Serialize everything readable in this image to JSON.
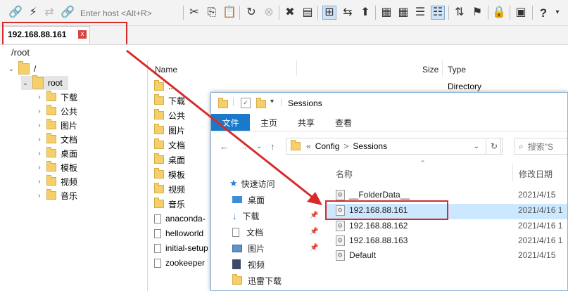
{
  "toolbar": {
    "host_placeholder": "Enter host <Alt+R>",
    "help_label": "?"
  },
  "tab": {
    "label": "192.168.88.161",
    "close": "x"
  },
  "path": "/root",
  "tree": {
    "root_slash": "/",
    "root_label": "root",
    "children": [
      "下载",
      "公共",
      "图片",
      "文档",
      "桌面",
      "模板",
      "视频",
      "音乐"
    ]
  },
  "filelist": {
    "headers": {
      "name": "Name",
      "size": "Size",
      "type": "Type"
    },
    "rows": [
      {
        "name": "..",
        "type": "Directory"
      },
      {
        "name": "下载"
      },
      {
        "name": "公共"
      },
      {
        "name": "图片"
      },
      {
        "name": "文档"
      },
      {
        "name": "桌面"
      },
      {
        "name": "模板"
      },
      {
        "name": "视频"
      },
      {
        "name": "音乐"
      },
      {
        "name": "anaconda-"
      },
      {
        "name": "helloworld"
      },
      {
        "name": "initial-setup"
      },
      {
        "name": "zookeeper"
      }
    ]
  },
  "explorer": {
    "title": "Sessions",
    "ribbon": {
      "file": "文件",
      "home": "主页",
      "share": "共享",
      "view": "查看"
    },
    "breadcrumb": {
      "sep": "«",
      "part1": "Config",
      "arrow": ">",
      "part2": "Sessions"
    },
    "search_placeholder": "搜索\"S",
    "nav_items": [
      "快速访问",
      "桌面",
      "下载",
      "文档",
      "图片",
      "视频",
      "迅雷下载"
    ],
    "columns": {
      "name": "名称",
      "date": "修改日期"
    },
    "files": [
      {
        "name": "__FolderData__",
        "date": "2021/4/15"
      },
      {
        "name": "192.168.88.161",
        "date": "2021/4/16 1"
      },
      {
        "name": "192.168.88.162",
        "date": "2021/4/16 1"
      },
      {
        "name": "192.168.88.163",
        "date": "2021/4/16 1"
      },
      {
        "name": "Default",
        "date": "2021/4/15"
      }
    ]
  },
  "colors": {
    "accent": "#1979ca",
    "highlight": "#d62b2b",
    "selection": "#cce8ff"
  }
}
